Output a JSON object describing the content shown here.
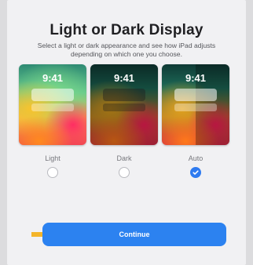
{
  "screen": {
    "title": "Light or Dark Display",
    "subtitle": "Select a light or dark appearance and see how iPad adjusts depending on which one you choose."
  },
  "options": [
    {
      "label": "Light",
      "time": "9:41",
      "selected": false
    },
    {
      "label": "Dark",
      "time": "9:41",
      "selected": false
    },
    {
      "label": "Auto",
      "time": "9:41",
      "selected": true
    }
  ],
  "continue_button": {
    "label": "Continue"
  },
  "colors": {
    "accent": "#2c82f0",
    "arrow": "#f4b52a",
    "background": "#f1f1f3"
  },
  "icons": {
    "selected_indicator": "checkmark-icon",
    "pointer": "arrow-right-icon"
  }
}
